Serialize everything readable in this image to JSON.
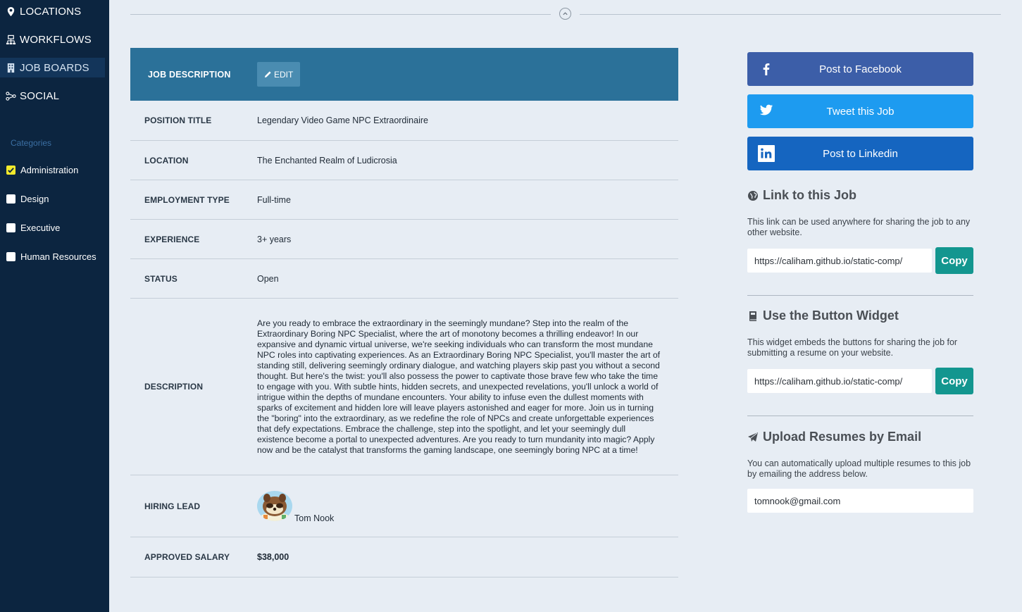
{
  "sidebar": {
    "nav": [
      {
        "label": "LOCATIONS",
        "icon": "map-pin-icon"
      },
      {
        "label": "WORKFLOWS",
        "icon": "workflow-icon"
      },
      {
        "label": "JOB BOARDS",
        "icon": "building-icon"
      },
      {
        "label": "SOCIAL",
        "icon": "share-nodes-icon"
      }
    ],
    "categories_heading": "Categories",
    "categories": [
      {
        "label": "Administration",
        "checked": true
      },
      {
        "label": "Design",
        "checked": false
      },
      {
        "label": "Executive",
        "checked": false
      },
      {
        "label": "Human Resources",
        "checked": false
      }
    ]
  },
  "job": {
    "header_title": "JOB DESCRIPTION",
    "edit_label": "EDIT",
    "rows": [
      {
        "label": "POSITION TITLE",
        "value": "Legendary Video Game NPC Extraordinaire"
      },
      {
        "label": "LOCATION",
        "value": "The Enchanted Realm of Ludicrosia"
      },
      {
        "label": "EMPLOYMENT TYPE",
        "value": "Full-time"
      },
      {
        "label": "EXPERIENCE",
        "value": "3+ years"
      },
      {
        "label": "STATUS",
        "value": "Open"
      },
      {
        "label": "DESCRIPTION",
        "value": "Are you ready to embrace the extraordinary in the seemingly mundane? Step into the realm of the Extraordinary Boring NPC Specialist, where the art of monotony becomes a thrilling endeavor! In our expansive and dynamic virtual universe, we're seeking individuals who can transform the most mundane NPC roles into captivating experiences. As an Extraordinary Boring NPC Specialist, you'll master the art of standing still, delivering seemingly ordinary dialogue, and watching players skip past you without a second thought. But here's the twist: you'll also possess the power to captivate those brave few who take the time to engage with you. With subtle hints, hidden secrets, and unexpected revelations, you'll unlock a world of intrigue within the depths of mundane encounters. Your ability to infuse even the dullest moments with sparks of excitement and hidden lore will leave players astonished and eager for more. Join us in turning the \"boring\" into the extraordinary, as we redefine the role of NPCs and create unforgettable experiences that defy expectations. Embrace the challenge, step into the spotlight, and let your seemingly dull existence become a portal to unexpected adventures. Are you ready to turn mundanity into magic? Apply now and be the catalyst that transforms the gaming landscape, one seemingly boring NPC at a time!"
      },
      {
        "label": "HIRING LEAD",
        "value": "Tom Nook"
      },
      {
        "label": "APPROVED SALARY",
        "value": "$38,000"
      }
    ]
  },
  "share": {
    "facebook_label": "Post to Facebook",
    "twitter_label": "Tweet this Job",
    "linkedin_label": "Post to Linkedin",
    "link_title": "Link to this Job",
    "link_desc": "This link can be used anywhere for sharing the job to any other website.",
    "link_url": "https://caliham.github.io/static-comp/",
    "copy_label": "Copy",
    "widget_title": "Use the Button Widget",
    "widget_desc": "This widget embeds the buttons for sharing the job for submitting a resume on your website.",
    "widget_url": "https://caliham.github.io/static-comp/",
    "email_title": "Upload Resumes by Email",
    "email_desc": "You can automatically upload multiple resumes to this job by emailing the address below.",
    "email_value": "tomnook@gmail.com"
  },
  "colors": {
    "sidebar_bg": "#0c2540",
    "header_bg": "#2b7199",
    "facebook": "#3c5ea8",
    "twitter": "#1d9bf0",
    "linkedin": "#1565c0",
    "copy_button": "#13968f",
    "checkbox_checked": "#f2ea2c"
  }
}
